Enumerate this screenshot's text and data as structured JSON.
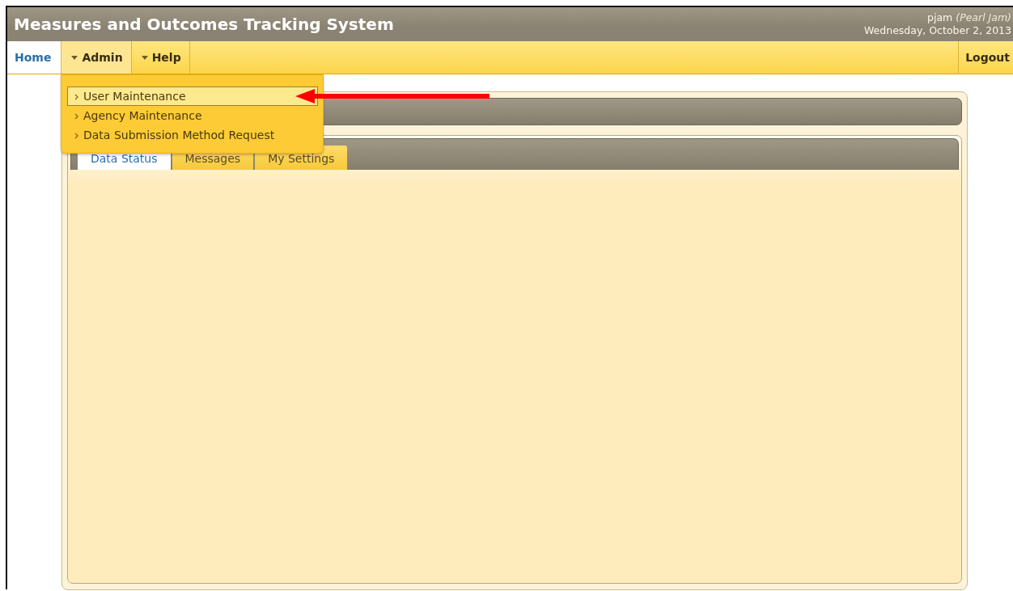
{
  "header": {
    "title": "Measures and Outcomes Tracking System",
    "user": "pjam",
    "user_full_name": "(Pearl Jam)",
    "date": "Wednesday, October 2, 2013"
  },
  "nav": {
    "items": [
      {
        "label": "Home",
        "kind": "link"
      },
      {
        "label": "Admin",
        "kind": "menu",
        "expanded": true
      },
      {
        "label": "Help",
        "kind": "menu",
        "expanded": false
      }
    ],
    "logout": "Logout"
  },
  "admin_menu": [
    {
      "label": "User Maintenance",
      "selected": true
    },
    {
      "label": "Agency Maintenance",
      "selected": false
    },
    {
      "label": "Data Submission Method Request",
      "selected": false
    }
  ],
  "tabs": [
    {
      "label": "Data Status",
      "selected": true
    },
    {
      "label": "Messages",
      "selected": false
    },
    {
      "label": "My Settings",
      "selected": false
    }
  ],
  "annotation": {
    "kind": "arrow",
    "color": "#ff0000"
  }
}
